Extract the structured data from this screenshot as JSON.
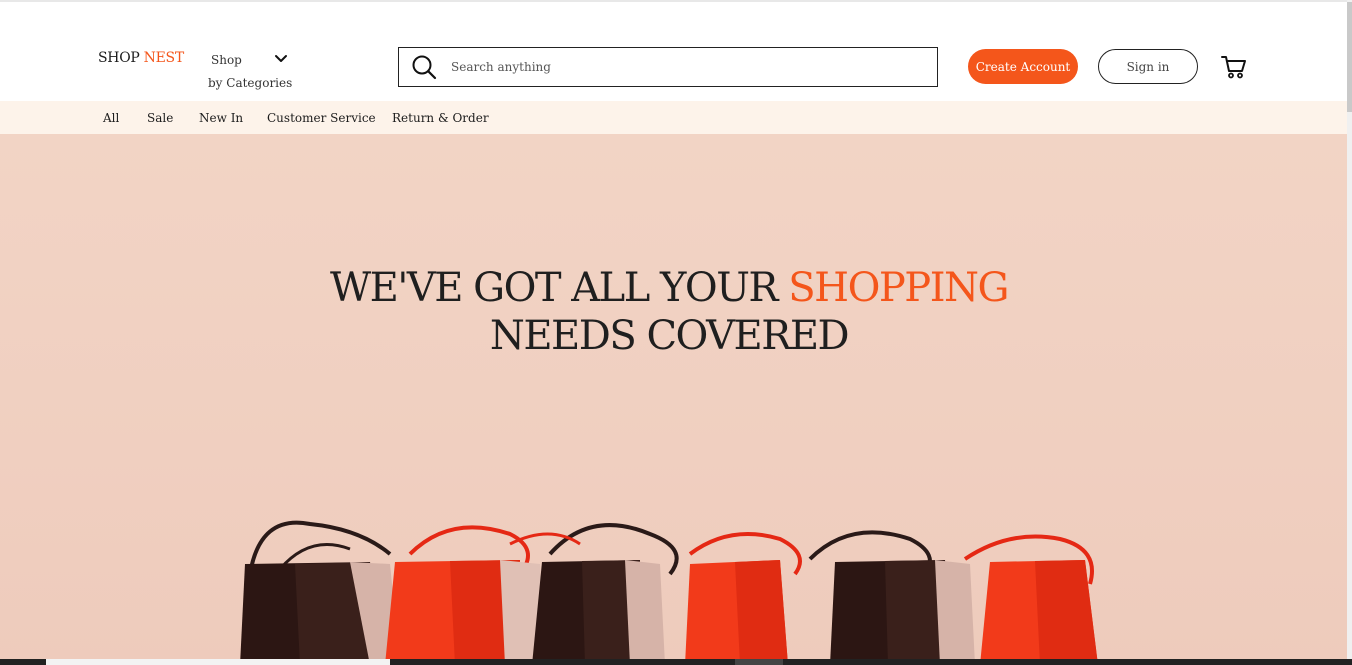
{
  "header": {
    "logo_text": "SHOP",
    "logo_accent": "NEST",
    "shop_line1": "Shop",
    "shop_line2": "by Categories",
    "search_placeholder": "Search anything",
    "create_account_label": "Create Account",
    "sign_in_label": "Sign in"
  },
  "subnav": {
    "items": [
      {
        "label": "All"
      },
      {
        "label": "Sale"
      },
      {
        "label": "New In"
      },
      {
        "label": "Customer Service"
      },
      {
        "label": "Return & Order"
      }
    ]
  },
  "hero": {
    "line1_prefix": "WE'VE GOT ALL YOUR",
    "line1_accent": "SHOPPING",
    "line2": "NEEDS COVERED"
  },
  "icons": {
    "chevron": "chevron-down-icon",
    "search": "search-icon",
    "cart": "cart-icon"
  },
  "colors": {
    "accent": "#f4561b",
    "subnav_bg": "#fdf3ea",
    "hero_bg": "#f2d4c5",
    "text_dark": "#1f1f1f"
  }
}
